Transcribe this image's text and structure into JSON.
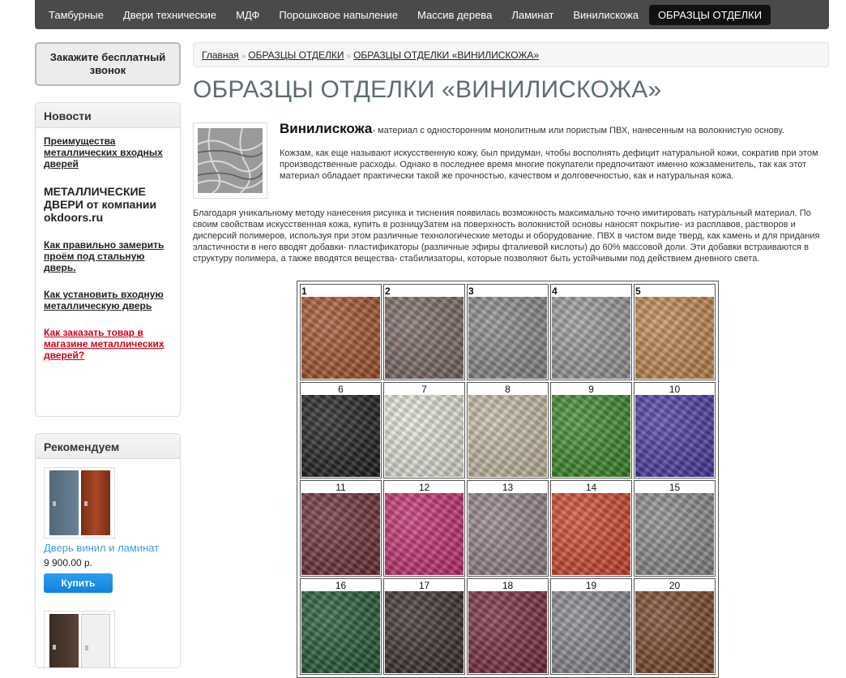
{
  "nav": {
    "items": [
      {
        "label": "Тамбурные",
        "active": false
      },
      {
        "label": "Двери технические",
        "active": false
      },
      {
        "label": "МДФ",
        "active": false
      },
      {
        "label": "Порошковое напыление",
        "active": false
      },
      {
        "label": "Массив дерева",
        "active": false
      },
      {
        "label": "Ламинат",
        "active": false
      },
      {
        "label": "Винилискожа",
        "active": false
      },
      {
        "label": "ОБРАЗЦЫ ОТДЕЛКИ",
        "active": true
      }
    ]
  },
  "sidebar": {
    "callback_label": "Закажите бесплатный звонок",
    "news": {
      "title": "Новости",
      "items": [
        {
          "label": "Преимущества металлических входных дверей",
          "style": "normal"
        },
        {
          "label": "МЕТАЛЛИЧЕСКИЕ ДВЕРИ от компании okdoors.ru",
          "style": "big"
        },
        {
          "label": "Как правильно замерить проём под стальную дверь.",
          "style": "normal"
        },
        {
          "label": "Как установить входную металлическую дверь",
          "style": "normal"
        },
        {
          "label": "Как заказать товар в магазине металлических дверей?",
          "style": "red"
        }
      ]
    },
    "recommend": {
      "title": "Рекомендуем",
      "products": [
        {
          "name": "Дверь винил и ламинат",
          "price": "9 900.00 р.",
          "buy_label": "Купить"
        }
      ]
    }
  },
  "breadcrumb": {
    "items": [
      "Главная",
      "ОБРАЗЦЫ ОТДЕЛКИ",
      "ОБРАЗЦЫ ОТДЕЛКИ «ВИНИЛИСКОЖА»"
    ],
    "separator": "»"
  },
  "page": {
    "title": "ОБРАЗЦЫ ОТДЕЛКИ «ВИНИЛИСКОЖА»",
    "intro_term": "Винилискожа",
    "intro_def": "- материал с односторонним монолитным или пористым ПВХ, нанесенным на волокнистую основу.",
    "intro_p2": "Кожзам, как еще называют искусственную кожу, был придуман, чтобы восполнять дефицит натуральной кожи, сократив при этом производственные расходы. Однако в последнее время многие покупатели предпочитают именно кожзаменитель, так как этот материал обладает практически такой же прочностью, качеством и долговечностью, как и натуральная кожа.",
    "body_text": "Благодаря уникальному методу нанесения рисунка и тиснения появилась возможность максимально точно имитировать натуральный материал. По своим свойствам искусственная кожа, купить в розницуЗатем на поверхность волокнистой основы наносят покрытие- из расплавов, растворов и дисперсий полимеров, используя при этом различные технологические методы и оборудование. ПВХ в чистом виде тверд, как камень и для придания эластичности в него вводят добавки- пластификаторы (различные эфиры фталиевой кислоты) до 60% массовой доли. Эти добавки встраиваются в структуру полимера, а также вводятся вещества- стабилизаторы, которые позволяют быть устойчивыми под действием дневного света."
  },
  "samples": [
    {
      "num": "1",
      "color": "#a8552e"
    },
    {
      "num": "2",
      "color": "#7d6a66"
    },
    {
      "num": "3",
      "color": "#8c8c8c"
    },
    {
      "num": "4",
      "color": "#9d9d9d"
    },
    {
      "num": "5",
      "color": "#c88a52"
    },
    {
      "num": "6",
      "color": "#1c1c1c"
    },
    {
      "num": "7",
      "color": "#ecebe1"
    },
    {
      "num": "8",
      "color": "#cbbfa9"
    },
    {
      "num": "9",
      "color": "#3c8a2a"
    },
    {
      "num": "10",
      "color": "#4e3aa6"
    },
    {
      "num": "11",
      "color": "#6d2e36"
    },
    {
      "num": "12",
      "color": "#c92e74"
    },
    {
      "num": "13",
      "color": "#958489"
    },
    {
      "num": "14",
      "color": "#d6462c"
    },
    {
      "num": "15",
      "color": "#8d8d8d"
    },
    {
      "num": "16",
      "color": "#1f5a32"
    },
    {
      "num": "17",
      "color": "#3a2c2c"
    },
    {
      "num": "18",
      "color": "#7a2a3e"
    },
    {
      "num": "19",
      "color": "#8a8c92"
    },
    {
      "num": "20",
      "color": "#7a4628"
    }
  ]
}
